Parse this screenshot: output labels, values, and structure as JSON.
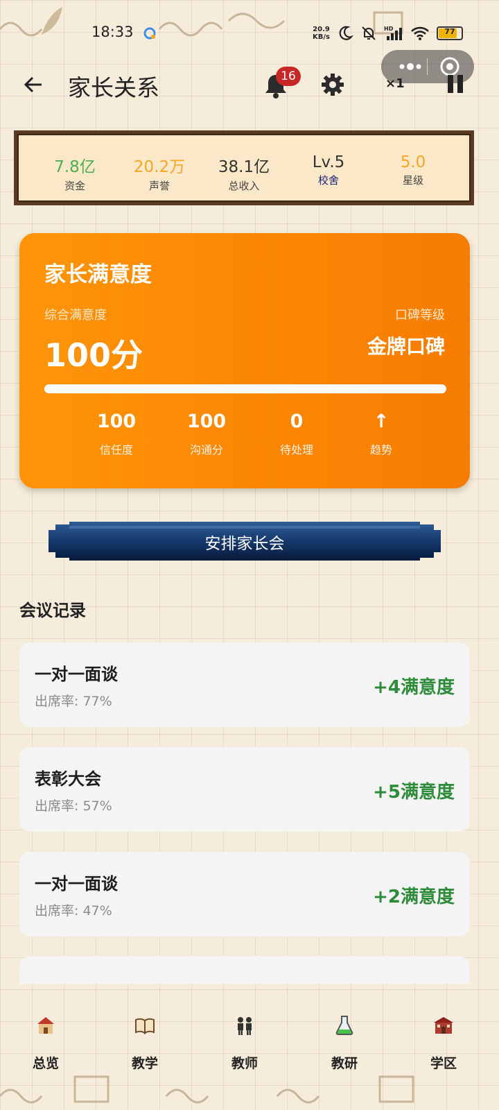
{
  "status_bar": {
    "time": "18:33",
    "net_speed_value": "20.9",
    "net_speed_unit": "KB/s",
    "battery": "77"
  },
  "header": {
    "title": "家长关系",
    "notification_count": "16",
    "speed_label": "×1"
  },
  "stats": [
    {
      "value": "7.8亿",
      "label": "资金",
      "value_color": "#4caf50",
      "label_color": "#444444"
    },
    {
      "value": "20.2万",
      "label": "声誉",
      "value_color": "#f5a623",
      "label_color": "#444444"
    },
    {
      "value": "38.1亿",
      "label": "总收入",
      "value_color": "#333333",
      "label_color": "#444444"
    },
    {
      "value": "Lv.5",
      "label": "校舍",
      "value_color": "#333333",
      "label_color": "#1a237e"
    },
    {
      "value": "5.0",
      "label": "星级",
      "value_color": "#f5a623",
      "label_color": "#444444"
    }
  ],
  "satisfaction": {
    "title": "家长满意度",
    "overall_label": "综合满意度",
    "overall_value": "100分",
    "reputation_label": "口碑等级",
    "reputation_value": "金牌口碑",
    "progress_fraction": 1.0,
    "metrics": [
      {
        "value": "100",
        "label": "信任度"
      },
      {
        "value": "100",
        "label": "沟通分"
      },
      {
        "value": "0",
        "label": "待处理"
      },
      {
        "value": "↑",
        "label": "趋势"
      }
    ]
  },
  "actions": {
    "arrange_meeting": "安排家长会"
  },
  "records": {
    "heading": "会议记录",
    "items": [
      {
        "name": "一对一面谈",
        "attendance": "出席率: 77%",
        "gain": "+4满意度"
      },
      {
        "name": "表彰大会",
        "attendance": "出席率: 57%",
        "gain": "+5满意度"
      },
      {
        "name": "一对一面谈",
        "attendance": "出席率: 47%",
        "gain": "+2满意度"
      }
    ]
  },
  "nav": [
    {
      "label": "总览",
      "icon": "school-house-icon"
    },
    {
      "label": "教学",
      "icon": "open-book-icon"
    },
    {
      "label": "教师",
      "icon": "teachers-icon"
    },
    {
      "label": "教研",
      "icon": "flask-icon"
    },
    {
      "label": "学区",
      "icon": "campus-building-icon"
    }
  ],
  "colors": {
    "accent_orange": "#f88a04",
    "gain_green": "#2e8b3a",
    "button_navy": "#0f2a55",
    "badge_red": "#c62828"
  }
}
